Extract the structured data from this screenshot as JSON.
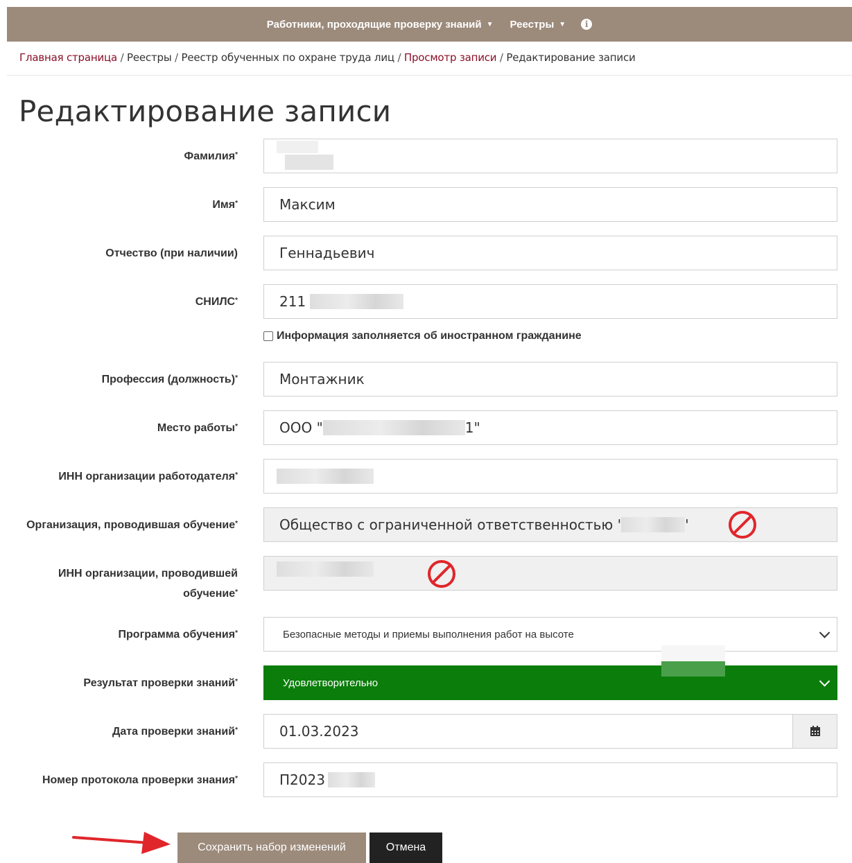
{
  "nav": {
    "menu1": "Работники, проходящие проверку знаний",
    "menu2": "Реестры",
    "info_icon": "i"
  },
  "breadcrumb": {
    "home": "Главная страница",
    "registries": "Реестры",
    "registry": "Реестр обученных по охране труда лиц",
    "view": "Просмотр записи",
    "current": "Редактирование записи",
    "sep": " / "
  },
  "page_title": "Редактирование записи",
  "req_mark": "*",
  "form": {
    "surname_label": "Фамилия",
    "name_label": "Имя",
    "name_value": "Максим",
    "patronymic_label": "Отчество (при наличии)",
    "patronymic_value": "Геннадьевич",
    "snils_label": "СНИЛС",
    "snils_value": "211",
    "foreigner_label": "Информация заполняется об иностранном гражданине",
    "profession_label": "Профессия (должность)",
    "profession_value": "Монтажник",
    "workplace_label": "Место работы",
    "workplace_prefix": "ООО \"",
    "workplace_suffix": "1\"",
    "employer_inn_label": "ИНН организации работодателя",
    "training_org_label": "Организация, проводившая обучение",
    "training_org_value": "Общество с ограниченной ответственностью '",
    "training_org_suffix": "'",
    "training_org_inn_label_1": "ИНН организации, проводившей",
    "training_org_inn_label_2": "обучение",
    "program_label": "Программа обучения",
    "program_value": "Безопасные методы и приемы выполнения работ на высоте",
    "result_label": "Результат проверки знаний",
    "result_value": "Удовлетворительно",
    "date_label": "Дата проверки знаний",
    "date_value": "01.03.2023",
    "protocol_label": "Номер протокола проверки знания",
    "protocol_value": "П2023"
  },
  "buttons": {
    "save": "Сохранить набор изменений",
    "cancel": "Отмена"
  },
  "colors": {
    "nav_bg": "#9c8a7b",
    "link": "#8a1028",
    "result_ok": "#0a7d0a",
    "forbid": "#e0262b",
    "arrow": "#e0262b"
  },
  "icons": {
    "forbid": "no-entry-icon",
    "calendar": "calendar-icon",
    "dropdown": "chevron-down-icon",
    "info": "info-icon",
    "arrow": "arrow-right-icon"
  }
}
